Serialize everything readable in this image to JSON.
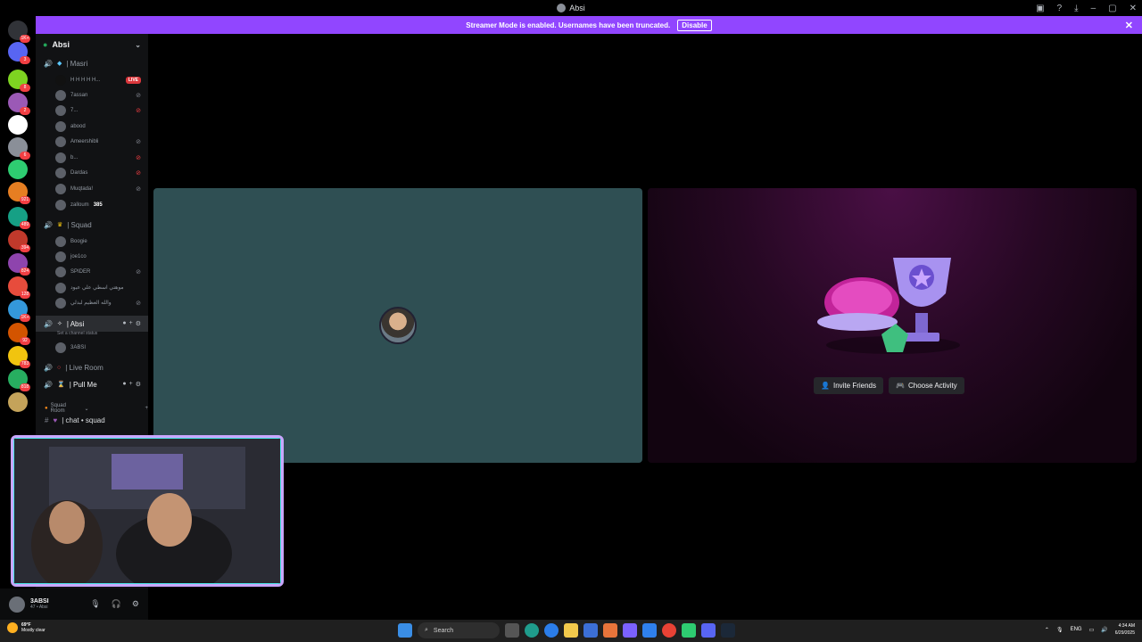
{
  "window": {
    "title": "Absi"
  },
  "banner": {
    "text": "Streamer Mode is enabled. Usernames have been truncated.",
    "button": "Disable"
  },
  "server": {
    "name": "Absi"
  },
  "guild_badges": [
    "1K+",
    "3",
    "8",
    "2",
    "6",
    "921",
    "489",
    "394",
    "824",
    "128",
    "1K+",
    "92",
    "783",
    "818"
  ],
  "channels": {
    "masri": {
      "label": "| Masri"
    },
    "masri_users": [
      {
        "name": "H H H H H...",
        "live": "LIVE"
      },
      {
        "name": "7assan"
      },
      {
        "name": "7..."
      },
      {
        "name": "abood"
      },
      {
        "name": "Ameershibli"
      },
      {
        "name": "b..."
      },
      {
        "name": "Dardas"
      },
      {
        "name": "Muqtada!"
      },
      {
        "name": "zalloum",
        "extra": "385"
      }
    ],
    "squad": {
      "label": "| Squad"
    },
    "squad_users": [
      {
        "name": "Boogie"
      },
      {
        "name": "joe1co"
      },
      {
        "name": "SPIDER"
      },
      {
        "name": "موهتي اسطي علي عيود"
      },
      {
        "name": "والله العظيم لبدلي"
      }
    ],
    "absi": {
      "label": "| Absi",
      "status": "Set a channel status"
    },
    "absi_users": [
      {
        "name": "3ABSI"
      }
    ],
    "live_room": {
      "label": "| Live Room"
    },
    "pull_me": {
      "label": "| Pull Me"
    },
    "category": {
      "label": "Squad Room"
    },
    "text_channel": {
      "label": "| chat • squad"
    }
  },
  "user_panel": {
    "name": "3ABSI",
    "sub": "47 • Absi"
  },
  "activity": {
    "invite": "Invite Friends",
    "choose": "Choose Activity"
  },
  "taskbar": {
    "weather_temp": "69°F",
    "weather_desc": "Mostly clear",
    "search": "Search",
    "lang": "ENG",
    "time": "4:34 AM",
    "date": "6/29/2025"
  }
}
